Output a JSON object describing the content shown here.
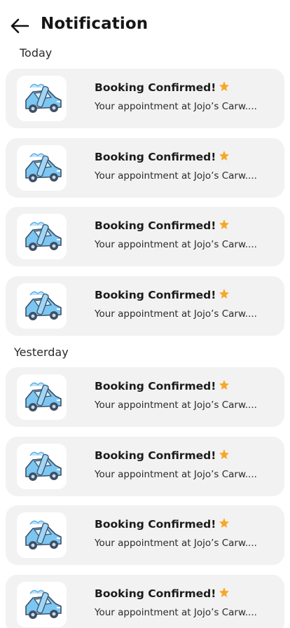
{
  "header": {
    "title": "Notification",
    "back_icon": "arrow-left-icon"
  },
  "sections": [
    {
      "label": "Today",
      "items": [
        {
          "title": "Booking Confirmed!",
          "subtitle": "Your appointment at Jojo’s Carw....",
          "icon": "car-wash-icon",
          "badge_icon": "star-icon"
        },
        {
          "title": "Booking Confirmed!",
          "subtitle": "Your appointment at Jojo’s Carw....",
          "icon": "car-wash-icon",
          "badge_icon": "star-icon"
        },
        {
          "title": "Booking Confirmed!",
          "subtitle": "Your appointment at Jojo’s Carw....",
          "icon": "car-wash-icon",
          "badge_icon": "star-icon"
        },
        {
          "title": "Booking Confirmed!",
          "subtitle": "Your appointment at Jojo’s Carw....",
          "icon": "car-wash-icon",
          "badge_icon": "star-icon"
        }
      ]
    },
    {
      "label": "Yesterday",
      "items": [
        {
          "title": "Booking Confirmed!",
          "subtitle": "Your appointment at Jojo’s Carw....",
          "icon": "car-wash-icon",
          "badge_icon": "star-icon"
        },
        {
          "title": "Booking Confirmed!",
          "subtitle": "Your appointment at Jojo’s Carw....",
          "icon": "car-wash-icon",
          "badge_icon": "star-icon"
        },
        {
          "title": "Booking Confirmed!",
          "subtitle": "Your appointment at Jojo’s Carw....",
          "icon": "car-wash-icon",
          "badge_icon": "star-icon"
        },
        {
          "title": "Booking Confirmed!",
          "subtitle": "Your appointment at Jojo’s Carw....",
          "icon": "car-wash-icon",
          "badge_icon": "star-icon"
        }
      ]
    }
  ],
  "colors": {
    "card_background": "#f2f2f2",
    "star": "#f7a824",
    "car_body": "#7cc6f2",
    "car_dark": "#3c4f66"
  }
}
